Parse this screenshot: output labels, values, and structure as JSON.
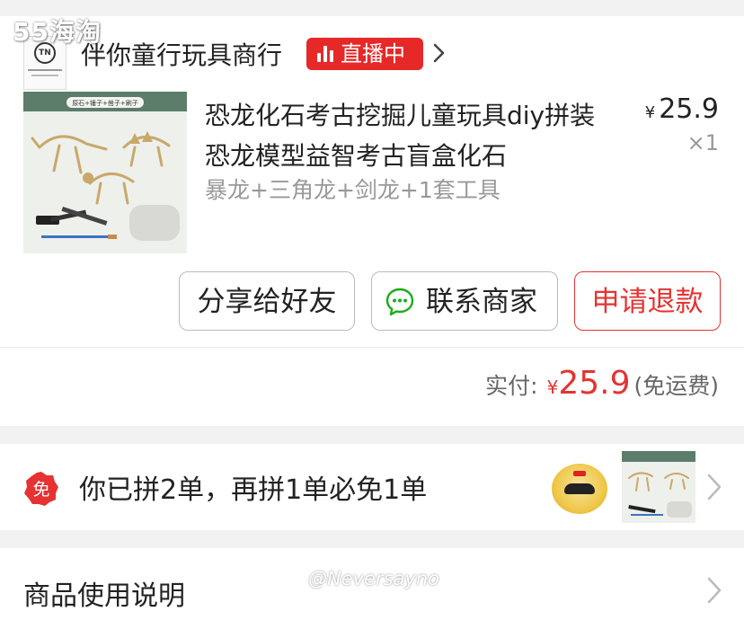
{
  "watermark": {
    "logo_text": "55海淘",
    "user_tag": "@Neversayno"
  },
  "shop": {
    "name": "伴你童行玩具商行",
    "logo_initials": "TN",
    "live_badge": "直播中",
    "icons": {
      "live": "live-bars-icon",
      "chevron": "chevron-right-icon"
    }
  },
  "product": {
    "title": "恐龙化石考古挖掘儿童玩具diy拼装恐龙模型益智考古盲盒化石",
    "spec": "暴龙+三角龙+剑龙+1套工具",
    "price_symbol": "¥",
    "price": "25.9",
    "quantity": "×1",
    "image_banner": "原石+锤子+凿子+刷子"
  },
  "actions": {
    "share": "分享给好友",
    "contact": "联系商家",
    "refund": "申请退款"
  },
  "payment": {
    "label": "实付:",
    "symbol": "¥",
    "amount": "25.9",
    "note": "(免运费)"
  },
  "group_buy": {
    "badge": "免",
    "text": "你已拼2单，再拼1单必免1单"
  },
  "manual": {
    "label": "商品使用说明"
  },
  "colors": {
    "accent_red": "#e63232",
    "live_red": "#e62828",
    "wechat_green": "#1aad19",
    "muted_text": "#999999",
    "page_bg": "#f2f2f2"
  }
}
